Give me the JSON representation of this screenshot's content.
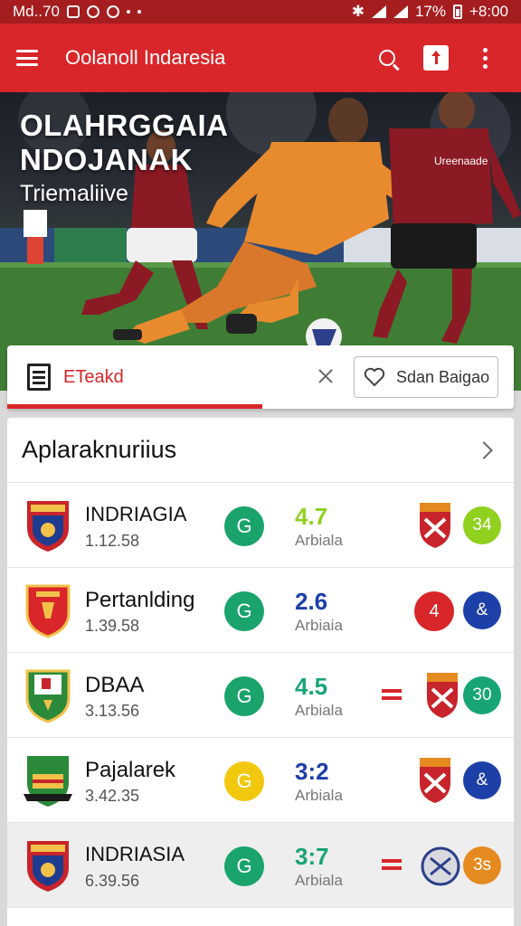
{
  "status_bar": {
    "left_text": "Md..70",
    "battery": "17%",
    "time": "+8:00"
  },
  "app_bar": {
    "title": "Oolanoll Indaresia",
    "icons": [
      "menu-icon",
      "search-icon",
      "share-icon",
      "more-vert-icon"
    ]
  },
  "hero": {
    "title_line1": "OLAHRGGAIA",
    "title_line2": "NDOJANAK",
    "subtitle": "Triemaliive",
    "jersey_text": "Ureenaade"
  },
  "tabs": {
    "active_label": "ETeakd",
    "fav_label": "Sdan Baigao"
  },
  "list": {
    "title": "Aplaraknuriius",
    "rows": [
      {
        "team": "INDRIAGIA",
        "time": "1.12.58",
        "status": "G",
        "score": "4.7",
        "score_label": "Arbiala",
        "opp_text": "",
        "end": "34"
      },
      {
        "team": "Pertanlding",
        "time": "1.39.58",
        "status": "G",
        "score": "2.6",
        "score_label": "Arbiaia",
        "opp_text": "4",
        "end": "&"
      },
      {
        "team": "DBAA",
        "time": "3.13.56",
        "status": "G",
        "score": "4.5",
        "score_label": "Arbiala",
        "opp_text": "",
        "end": "30"
      },
      {
        "team": "Pajalarek",
        "time": "3.42.35",
        "status": "G",
        "score": "3:2",
        "score_label": "Arbiala",
        "opp_text": "",
        "end": "&"
      },
      {
        "team": "INDRIASIA",
        "time": "6.39.56",
        "status": "G",
        "score": "3:7",
        "score_label": "Arbiala",
        "opp_text": "",
        "end": "3s"
      }
    ]
  },
  "colors": {
    "brand_red": "#d8262a",
    "status_green": "#1aa36b",
    "status_yellow": "#f2c80f",
    "lime": "#8fd11e",
    "teal": "#17a573",
    "navy": "#1d3fa8",
    "orange": "#e58a1f",
    "badge_red": "#d8262a"
  }
}
